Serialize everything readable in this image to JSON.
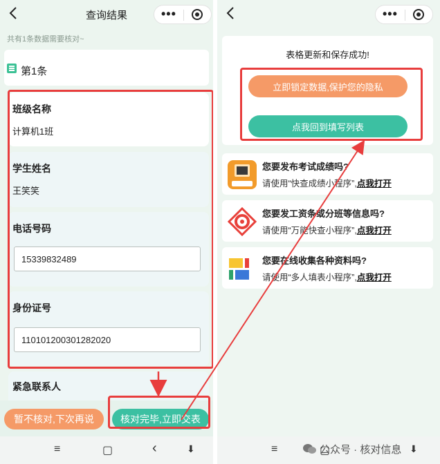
{
  "left": {
    "nav": {
      "back_icon": "chevron-left-icon",
      "title": "查询结果",
      "more_glyph": "•••"
    },
    "notice": "共有1条数据需要核对~",
    "item_no": "第1条",
    "fields": {
      "class_name": {
        "label": "班级名称",
        "value": "计算机1班"
      },
      "student_name": {
        "label": "学生姓名",
        "value": "王笑笑"
      },
      "phone": {
        "label": "电话号码",
        "value": "15339832489"
      },
      "id_card": {
        "label": "身份证号",
        "value": "110101200301282020"
      },
      "emergency": {
        "label": "紧急联系人"
      }
    },
    "buttons": {
      "later": "暂不核对,下次再说",
      "submit": "核对完毕,立即交表"
    },
    "sys_nav": {
      "menu": "≡",
      "home": "▢",
      "back": "‹",
      "down": "⬇"
    }
  },
  "right": {
    "nav": {
      "back_glyph": "‹",
      "more_glyph": "•••"
    },
    "success_text": "表格更新和保存成功!",
    "buttons": {
      "lock": "立即锁定数据,保护您的隐私",
      "back_to_list": "点我回到填写列表"
    },
    "promos": [
      {
        "title": "您要发布考试成绩吗?",
        "desc_prefix": "请使用“快查成绩小程序”,",
        "action": "点我打开",
        "icon_label": "查询入口"
      },
      {
        "title": "您要发工资条或分班等信息吗?",
        "desc_prefix": "请使用“万能快查小程序”,",
        "action": "点我打开"
      },
      {
        "title": "您要在线收集各种资料吗?",
        "desc_prefix": "请使用“多人填表小程序”,",
        "action": "点我打开"
      }
    ],
    "sys_nav": {
      "menu": "≡",
      "home": "▢",
      "down": "⬇"
    }
  },
  "watermark": "公众号 · 核对信息",
  "colors": {
    "red_highlight": "#e83d3d",
    "orange": "#f59a67",
    "green": "#3cc0a2",
    "accent": "#3cc195"
  }
}
